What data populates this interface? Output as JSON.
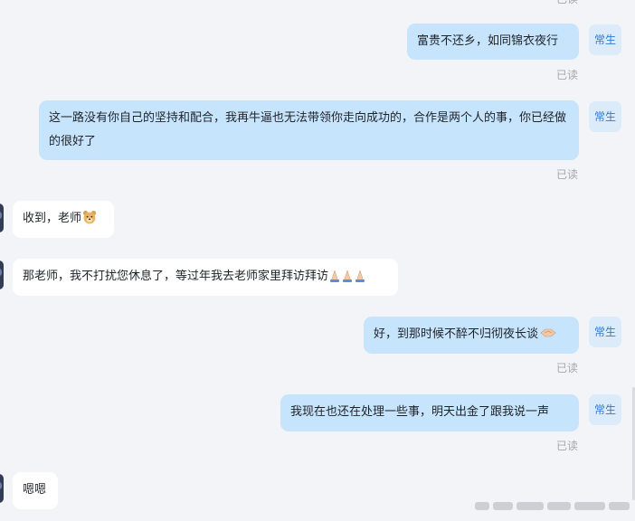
{
  "read_label": "已读",
  "me_avatar_label": "常生",
  "messages": [
    {
      "text": "富贵不还乡，如同锦衣夜行"
    },
    {
      "text": "这一路没有你自己的坚持和配合，我再牛逼也无法带领你走向成功的，合作是两个人的事，你已经做的很好了"
    },
    {
      "text": "收到，老师",
      "emoji": "bear-face-icon"
    },
    {
      "text": "那老师，我不打扰您休息了，等过年我去老师家里拜访拜访",
      "emoji": "folded-hands-icon"
    },
    {
      "text": "好，到那时候不醉不归彻夜长谈",
      "emoji": "handshake-icon"
    },
    {
      "text": "我现在也还在处理一些事，明天出金了跟我说一声"
    },
    {
      "text": "嗯嗯"
    }
  ],
  "colors": {
    "background": "#f3f4f7",
    "my_bubble": "#c7e4fd",
    "other_bubble": "#ffffff",
    "avatar_text": "#2f7bd3",
    "read_text": "#a3a7ae"
  }
}
